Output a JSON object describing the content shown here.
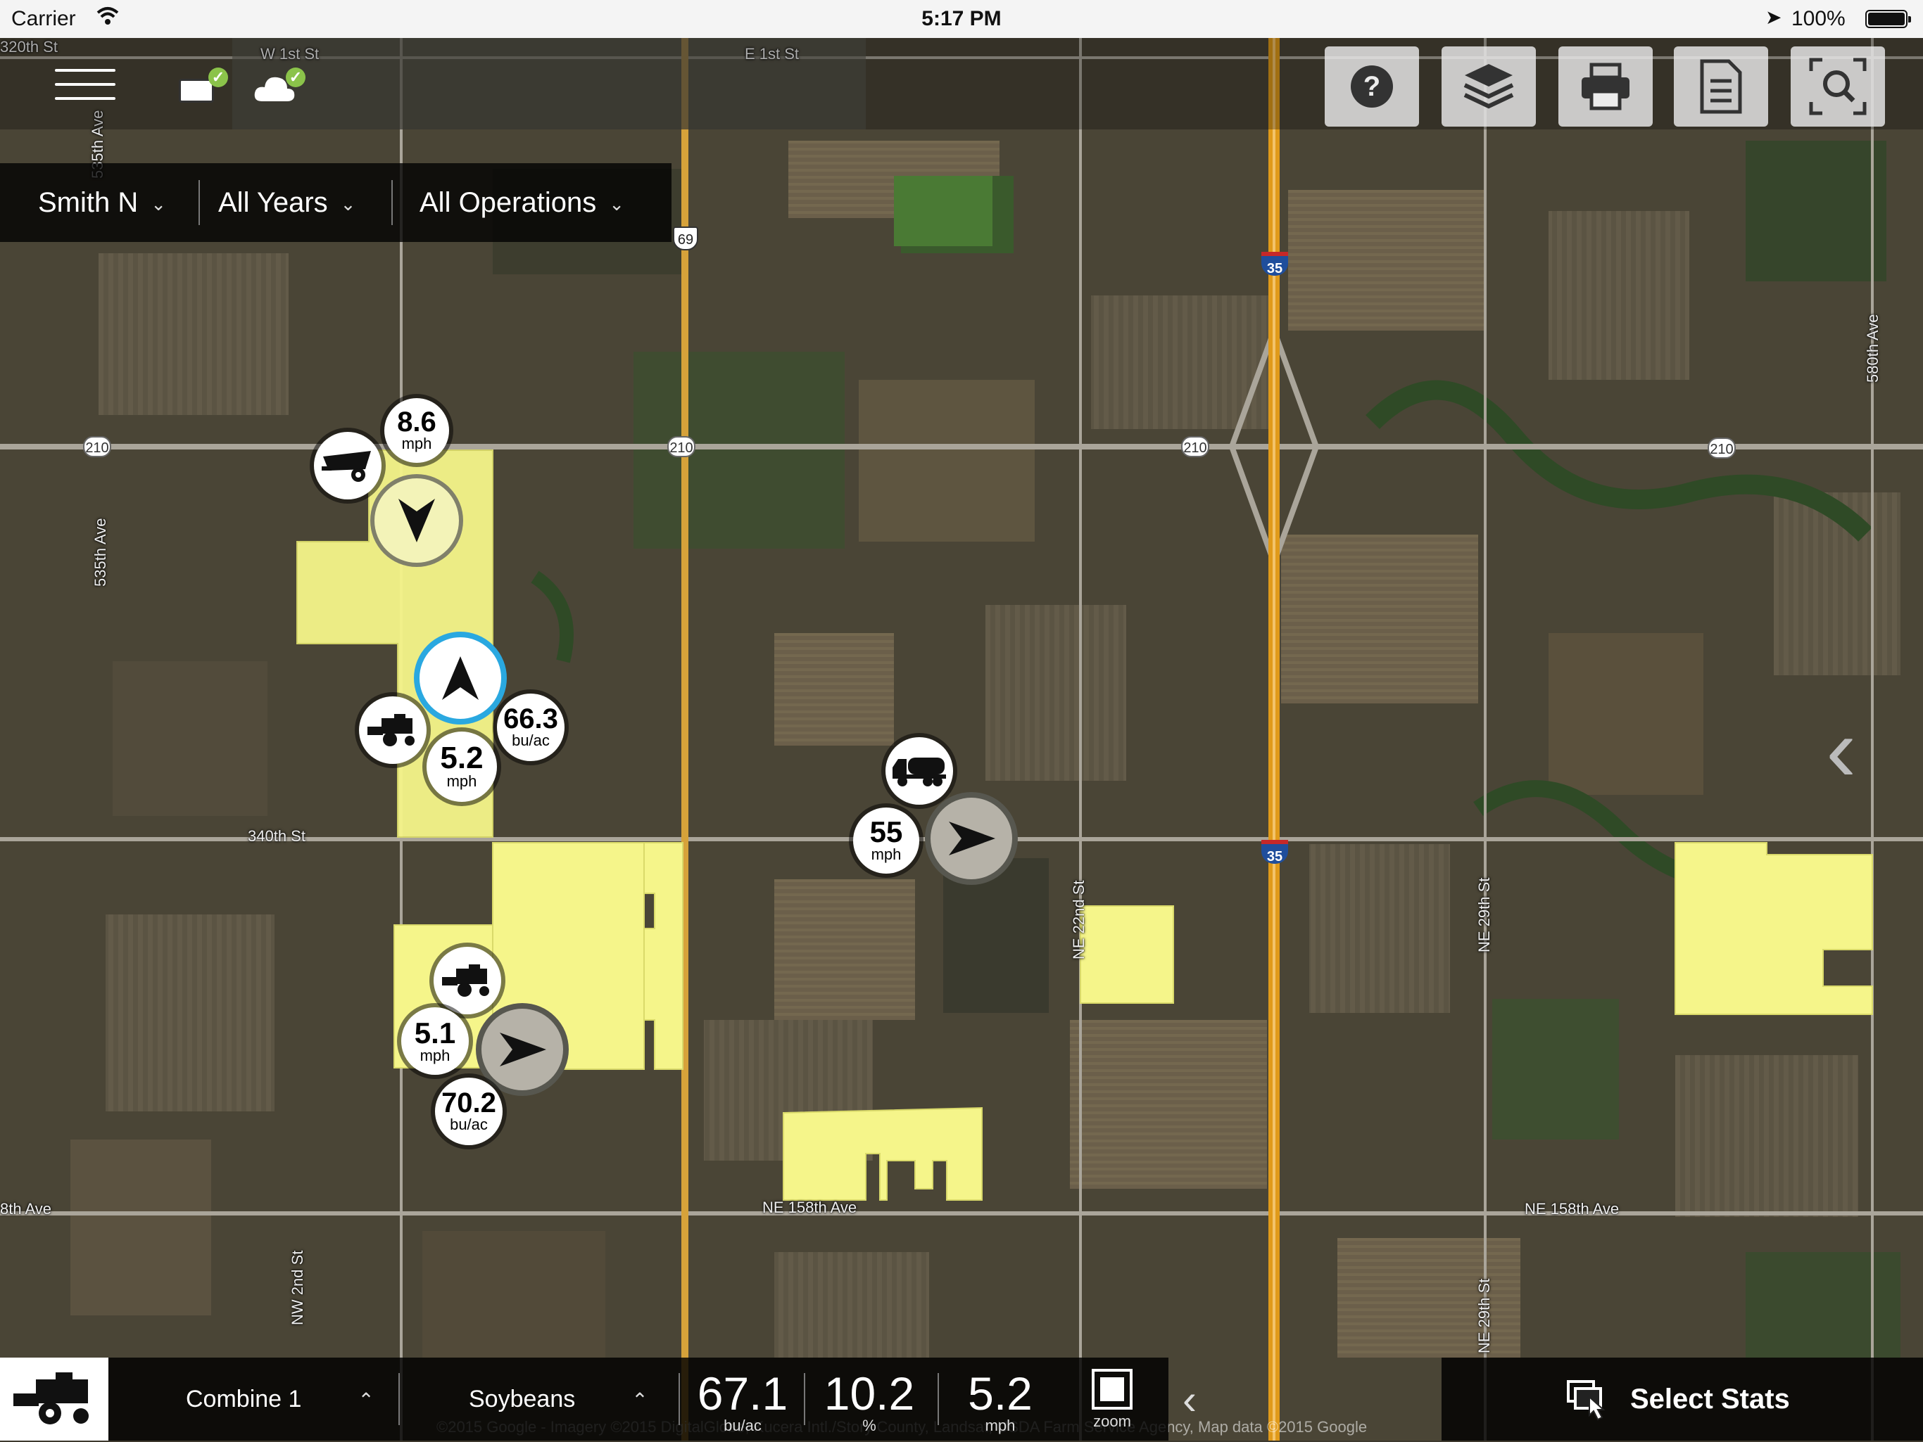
{
  "status_bar": {
    "carrier": "Carrier",
    "time": "5:17 PM",
    "battery": "100%"
  },
  "filters": [
    {
      "label": "Smith N"
    },
    {
      "label": "All Years"
    },
    {
      "label": "All Operations"
    }
  ],
  "toolbar": [
    "help-icon",
    "layers-icon",
    "print-icon",
    "document-icon",
    "zoom-extent-icon"
  ],
  "road_labels": {
    "w1st": "W 1st St",
    "e1st": "E 1st St",
    "s320": "320th St",
    "a535_top": "535th Ave",
    "a535": "535th Ave",
    "a580": "580th Ave",
    "s340": "340th St",
    "ne22": "NE 22nd St",
    "ne29_mid": "NE 29th St",
    "ne29_low": "NE 29th St",
    "nw2": "NW 2nd St",
    "ne158_mid": "NE 158th Ave",
    "ne158_right": "NE 158th Ave",
    "a8th": "8th Ave"
  },
  "shields": {
    "r210": "210",
    "us69": "69",
    "i35": "35"
  },
  "vehicles": {
    "grain_cart": {
      "speed": "8.6",
      "speed_unit": "mph"
    },
    "combine_a": {
      "yield": "66.3",
      "yield_unit": "bu/ac",
      "speed": "5.2",
      "speed_unit": "mph"
    },
    "truck": {
      "speed": "55",
      "speed_unit": "mph"
    },
    "combine_b": {
      "speed": "5.1",
      "speed_unit": "mph",
      "yield": "70.2",
      "yield_unit": "bu/ac"
    }
  },
  "bottom_bar": {
    "machine": "Combine 1",
    "crop": "Soybeans",
    "stats": [
      {
        "value": "67.1",
        "unit": "bu/ac"
      },
      {
        "value": "10.2",
        "unit": "%"
      },
      {
        "value": "5.2",
        "unit": "mph"
      }
    ],
    "zoom_label": "zoom",
    "select_stats": "Select Stats"
  },
  "attribution": "©2015 Google - Imagery ©2015 DigitalGlobe, Kucera Intl./Story County, Landsat, USDA Farm Service Agency, Map data ©2015 Google",
  "colors": {
    "field_highlight": "#f5f58a",
    "selected_ring": "#2aa8e0",
    "interstate": "#e09a1a"
  }
}
